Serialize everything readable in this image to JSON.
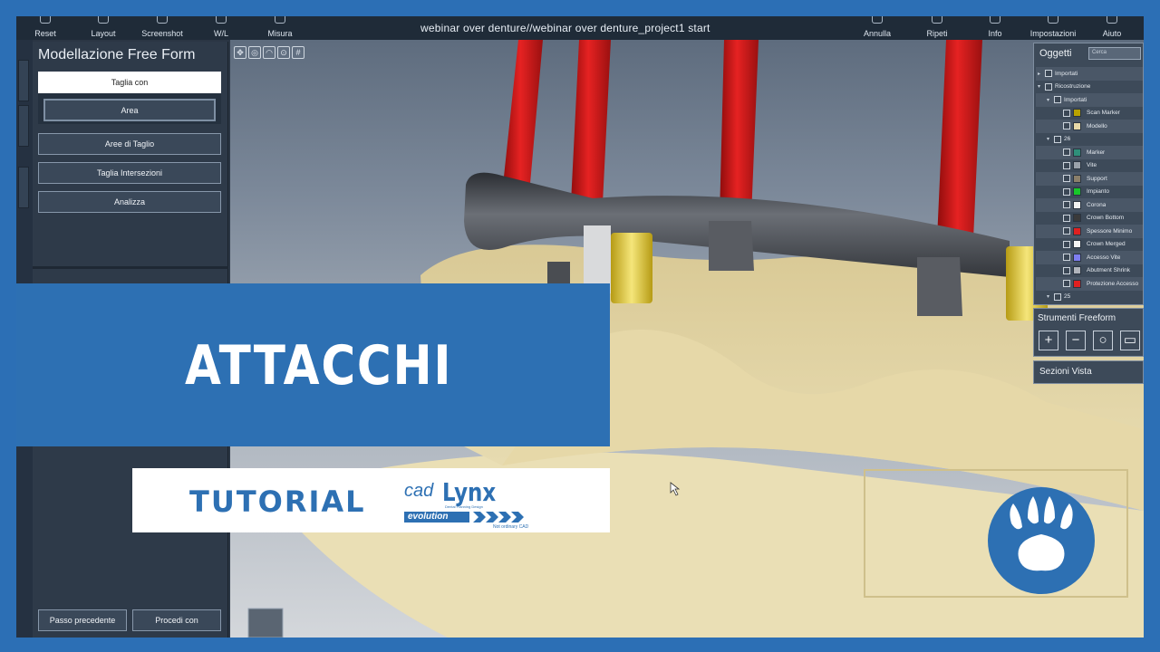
{
  "window_title": "webinar over denture//webinar over denture_project1 start",
  "toolbar": {
    "left": [
      {
        "label": "Reset",
        "icon": "reset-icon"
      },
      {
        "label": "Layout",
        "icon": "layout-icon"
      },
      {
        "label": "Screenshot",
        "icon": "camera-icon"
      },
      {
        "label": "W/L",
        "icon": "contrast-icon"
      },
      {
        "label": "Misura",
        "icon": "measure-icon"
      }
    ],
    "right": [
      {
        "label": "Annulla",
        "icon": "undo-icon"
      },
      {
        "label": "Ripeti",
        "icon": "redo-icon"
      },
      {
        "label": "Info",
        "icon": "info-icon"
      },
      {
        "label": "Impostazioni",
        "icon": "settings-icon"
      },
      {
        "label": "Aiuto",
        "icon": "help-icon"
      }
    ]
  },
  "left_panel": {
    "title": "Modellazione Free Form",
    "cut_with": "Taglia con",
    "area": "Area",
    "cut_areas": "Aree di Taglio",
    "cut_intersections": "Taglia Intersezioni",
    "analyze": "Analizza",
    "prev_step": "Passo precedente",
    "proceed": "Procedi con"
  },
  "objects_panel": {
    "title": "Oggetti",
    "search_placeholder": "Cerca",
    "items": [
      {
        "label": "Importati",
        "color": ""
      },
      {
        "label": "Ricostruzione",
        "color": ""
      },
      {
        "label": "Importati",
        "color": ""
      },
      {
        "label": "Scan Marker",
        "color": "#b8a200"
      },
      {
        "label": "Modello",
        "color": "#e7d9a8"
      },
      {
        "label": "26",
        "color": ""
      },
      {
        "label": "Marker",
        "color": "#2f8f7a"
      },
      {
        "label": "Vite",
        "color": "#9aa2ab"
      },
      {
        "label": "Support",
        "color": "#8a7f6a"
      },
      {
        "label": "Impianto",
        "color": "#18c82a"
      },
      {
        "label": "Corona",
        "color": "#f2f2f2"
      },
      {
        "label": "Crown Bottom",
        "color": "#3a3a3a"
      },
      {
        "label": "Spessore Minimo",
        "color": "#e02020"
      },
      {
        "label": "Crown Merged",
        "color": "#f4f4f4"
      },
      {
        "label": "Accesso Vite",
        "color": "#7e7ef0"
      },
      {
        "label": "Abutment Shrink",
        "color": "#b0b4bb"
      },
      {
        "label": "Protezione Accesso",
        "color": "#e02020"
      },
      {
        "label": "25",
        "color": ""
      }
    ]
  },
  "freeform": {
    "title": "Strumenti Freeform",
    "buttons": [
      "+",
      "−",
      "○",
      "▭"
    ]
  },
  "sections": {
    "title": "Sezioni Vista"
  },
  "overlay": {
    "banner_title": "ATTACCHI",
    "tutorial": "TUTORIAL",
    "logo": {
      "cad": "cad",
      "lynx": "Lynx",
      "sub": "Dental Planning Design",
      "evolution": "evolution",
      "tagline": "Not ordinary CAD"
    }
  },
  "colors": {
    "brand_blue": "#2d70b3",
    "rod_red": "#d21a1a",
    "model_beige": "#e1d3a0",
    "bar_dark": "#3c3f44",
    "attachment_yellow": "#e8d45a"
  }
}
